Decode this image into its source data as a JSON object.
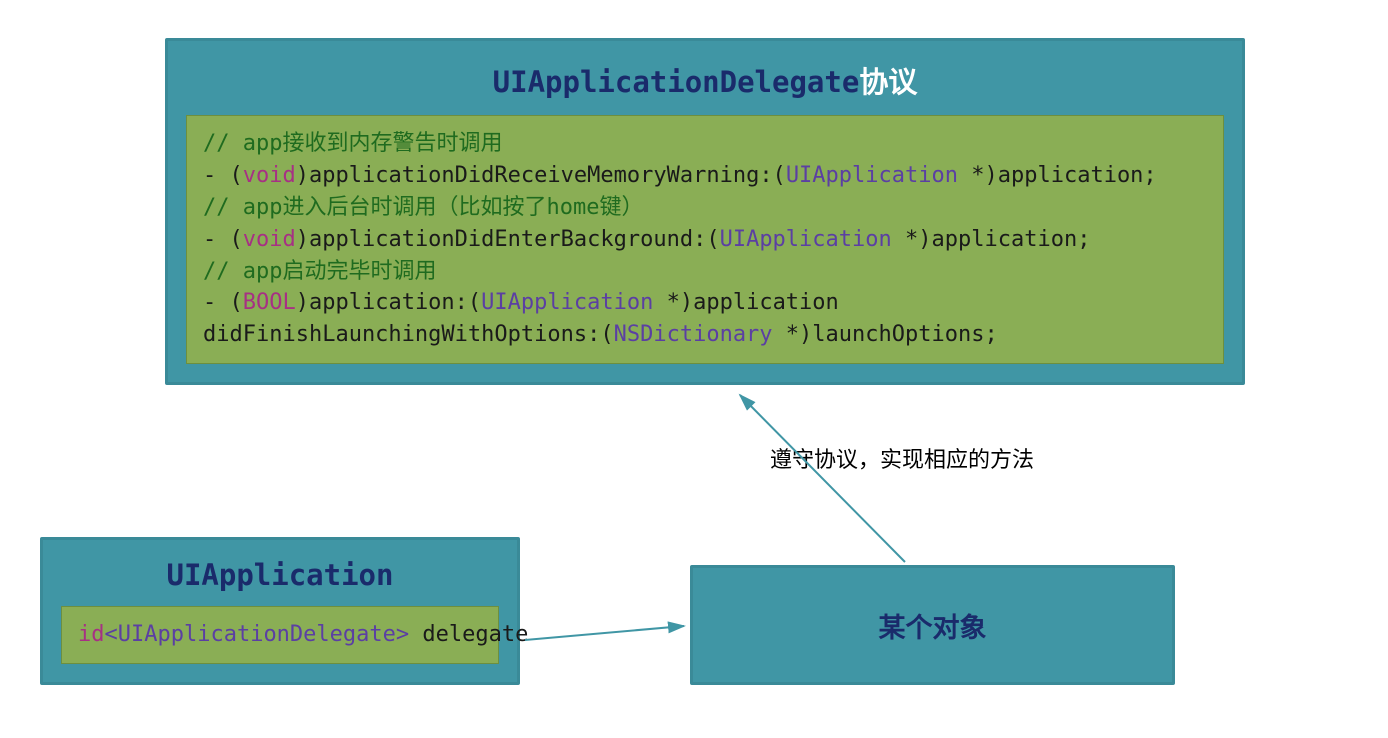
{
  "protocolBox": {
    "title_part1": "UIApplicationDelegate",
    "title_part2": "协议",
    "comment1": "// app接收到内存警告时调用",
    "line1_prefix": "- (",
    "line1_kw": "void",
    "line1_mid": ")applicationDidReceiveMemoryWarning:(",
    "line1_type": "UIApplication",
    "line1_suffix": " *)application;",
    "comment2": "// app进入后台时调用（比如按了home键）",
    "line2_prefix": "- (",
    "line2_kw": "void",
    "line2_mid": ")applicationDidEnterBackground:(",
    "line2_type": "UIApplication",
    "line2_suffix": " *)application;",
    "comment3": "// app启动完毕时调用",
    "line3_prefix": "- (",
    "line3_kw": "BOOL",
    "line3_mid": ")application:(",
    "line3_type": "UIApplication",
    "line3_suffix": " *)application",
    "line4_prefix": "didFinishLaunchingWithOptions:(",
    "line4_type": "NSDictionary",
    "line4_suffix": " *)launchOptions;"
  },
  "appBox": {
    "title": "UIApplication",
    "field_kw": "id",
    "field_type": "<UIApplicationDelegate>",
    "field_rest": " delegate"
  },
  "objBox": {
    "label": "某个对象"
  },
  "edgeLabel": "遵守协议，实现相应的方法",
  "colors": {
    "boxBg": "#4096a5",
    "boxBorder": "#3a8a98",
    "codeBg": "#8aae55",
    "titleDark": "#1a2b6b",
    "titleWhite": "#ffffff",
    "comment": "#1f6b1f",
    "keyword": "#a73084",
    "type": "#5b3fa3",
    "arrow": "#4096a5"
  }
}
